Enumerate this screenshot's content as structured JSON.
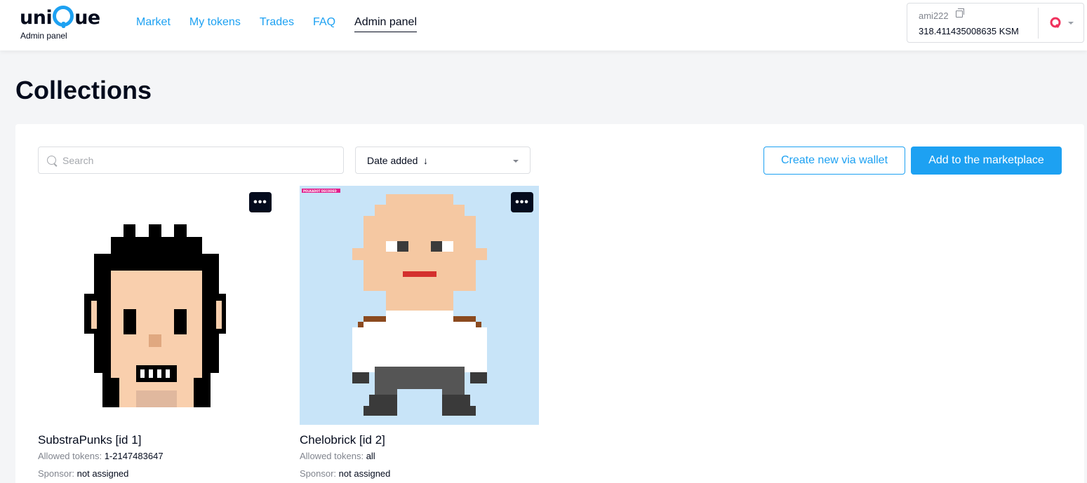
{
  "header": {
    "logo": {
      "text": "unique",
      "subtitle": "Admin panel"
    },
    "nav": [
      {
        "label": "Market",
        "active": false
      },
      {
        "label": "My tokens",
        "active": false
      },
      {
        "label": "Trades",
        "active": false
      },
      {
        "label": "FAQ",
        "active": false
      },
      {
        "label": "Admin panel",
        "active": true
      }
    ],
    "account": {
      "name": "ami222",
      "balance": "318.411435008635 KSM"
    }
  },
  "page": {
    "title": "Collections"
  },
  "toolbar": {
    "search_placeholder": "Search",
    "sort_label": "Date added",
    "sort_arrow": "↓",
    "create_label": "Create new via wallet",
    "add_label": "Add to the marketplace"
  },
  "collections": [
    {
      "title": "SubstraPunks [id 1]",
      "allowed_label": "Allowed tokens:",
      "allowed_value": "1-2147483647",
      "sponsor_label": "Sponsor:",
      "sponsor_value": "not assigned",
      "menu": "•••"
    },
    {
      "title": "Chelobrick [id 2]",
      "allowed_label": "Allowed tokens:",
      "allowed_value": "all",
      "sponsor_label": "Sponsor:",
      "sponsor_value": "not assigned",
      "menu": "•••",
      "badge": "POLKADOT DECODED"
    }
  ],
  "colors": {
    "accent": "#1da1f2",
    "text": "#040b1d",
    "muted": "#81858e",
    "page_bg": "#f4f5f7"
  }
}
